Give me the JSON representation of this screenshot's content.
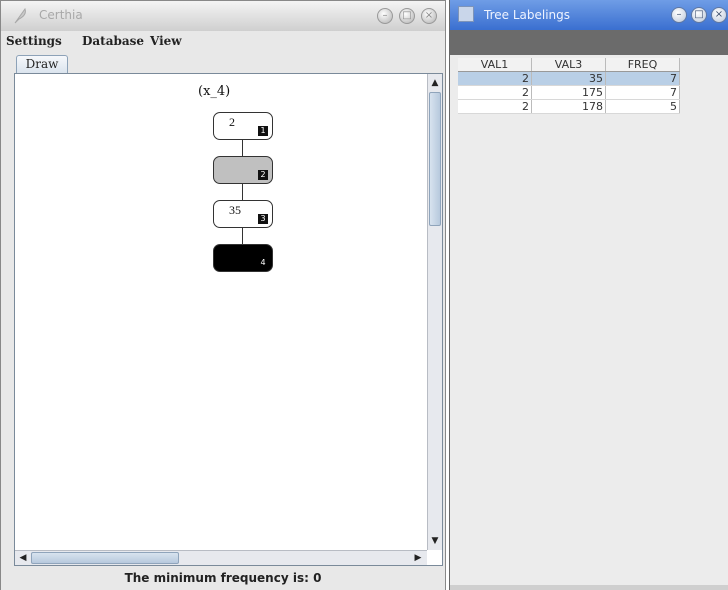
{
  "left_window": {
    "title": "Certhia",
    "menu": [
      "Settings",
      "Database",
      "View"
    ],
    "tab": "Draw",
    "tree": {
      "heading": "(x_4)",
      "nodes": [
        {
          "value": "2",
          "index": "1",
          "fill": "#ffffff"
        },
        {
          "value": "",
          "index": "2",
          "fill": "#c0c0c0"
        },
        {
          "value": "35",
          "index": "3",
          "fill": "#ffffff"
        },
        {
          "value": "",
          "index": "4",
          "fill": "#000000"
        }
      ]
    },
    "status": "The minimum frequency is: 0"
  },
  "right_window": {
    "title": "Tree Labelings",
    "columns": [
      "VAL1",
      "VAL3",
      "FREQ"
    ],
    "rows": [
      [
        "2",
        "35",
        "7"
      ],
      [
        "2",
        "175",
        "7"
      ],
      [
        "2",
        "178",
        "5"
      ]
    ],
    "selected_row": 0
  }
}
